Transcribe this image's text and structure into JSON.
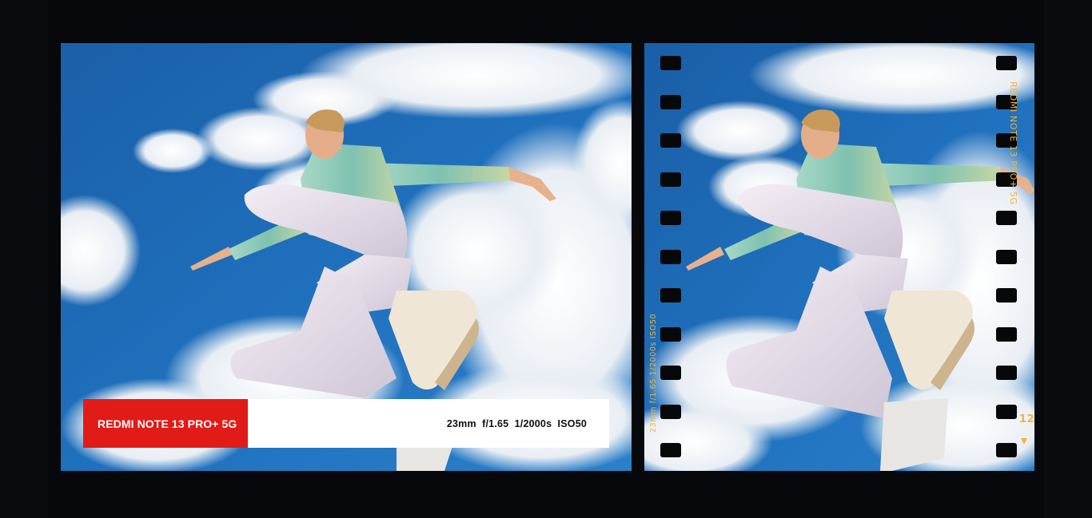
{
  "watermark": {
    "brand": "REDMI NOTE 13 PRO+ 5G",
    "specs": "23mm  f/1.65  1/2000s  ISO50",
    "brand_color": "#e11b17"
  },
  "film": {
    "brand": "REDMI NOTE 13 PRO+ 5G",
    "specs": "23mm f/1.65 1/2000s ISO50",
    "frame_number": "12",
    "text_color": "#f0b43a"
  },
  "scene": {
    "left_photo": "photo-jumping-man-sky",
    "right_photo": "photo-jumping-man-sky-film"
  }
}
